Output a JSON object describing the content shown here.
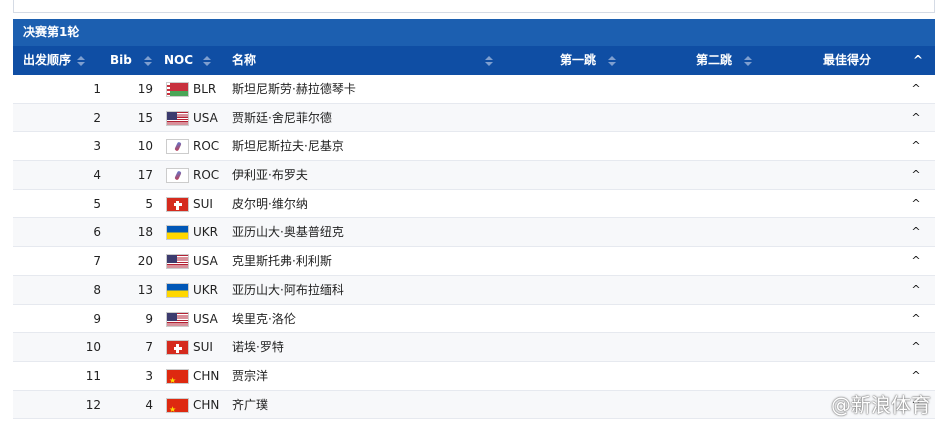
{
  "title": "决赛第1轮",
  "columns": {
    "order": "出发顺序",
    "bib": "Bib",
    "noc": "NOC",
    "name": "名称",
    "jump1": "第一跳",
    "jump2": "第二跳",
    "best": "最佳得分"
  },
  "collapse_icon": "^",
  "rows": [
    {
      "order": "1",
      "bib": "19",
      "flag": "belarus-flag",
      "noc": "BLR",
      "name": "斯坦尼斯劳·赫拉德琴卡",
      "toggle": "^"
    },
    {
      "order": "2",
      "bib": "15",
      "flag": "usa-flag",
      "noc": "USA",
      "name": "贾斯廷·舍尼菲尔德",
      "toggle": "^"
    },
    {
      "order": "3",
      "bib": "10",
      "flag": "roc-flag",
      "noc": "ROC",
      "name": "斯坦尼斯拉夫·尼基京",
      "toggle": "^"
    },
    {
      "order": "4",
      "bib": "17",
      "flag": "roc-flag",
      "noc": "ROC",
      "name": "伊利亚·布罗夫",
      "toggle": "^"
    },
    {
      "order": "5",
      "bib": "5",
      "flag": "switzerland-flag",
      "noc": "SUI",
      "name": "皮尔明·维尔纳",
      "toggle": "^"
    },
    {
      "order": "6",
      "bib": "18",
      "flag": "ukraine-flag",
      "noc": "UKR",
      "name": "亚历山大·奥基普纽克",
      "toggle": "^"
    },
    {
      "order": "7",
      "bib": "20",
      "flag": "usa-flag",
      "noc": "USA",
      "name": "克里斯托弗·利利斯",
      "toggle": "^"
    },
    {
      "order": "8",
      "bib": "13",
      "flag": "ukraine-flag",
      "noc": "UKR",
      "name": "亚历山大·阿布拉缅科",
      "toggle": "^"
    },
    {
      "order": "9",
      "bib": "9",
      "flag": "usa-flag",
      "noc": "USA",
      "name": "埃里克·洛伦",
      "toggle": "^"
    },
    {
      "order": "10",
      "bib": "7",
      "flag": "switzerland-flag",
      "noc": "SUI",
      "name": "诺埃·罗特",
      "toggle": "^"
    },
    {
      "order": "11",
      "bib": "3",
      "flag": "china-flag",
      "noc": "CHN",
      "name": "贾宗洋",
      "toggle": "^"
    },
    {
      "order": "12",
      "bib": "4",
      "flag": "china-flag",
      "noc": "CHN",
      "name": "齐广璞",
      "toggle": "^"
    }
  ],
  "watermark": "@新浪体育",
  "colors": {
    "title_bar": "#1c5fb0",
    "header_row": "#0f4ea4",
    "row_alt": "#f7f8fa"
  }
}
